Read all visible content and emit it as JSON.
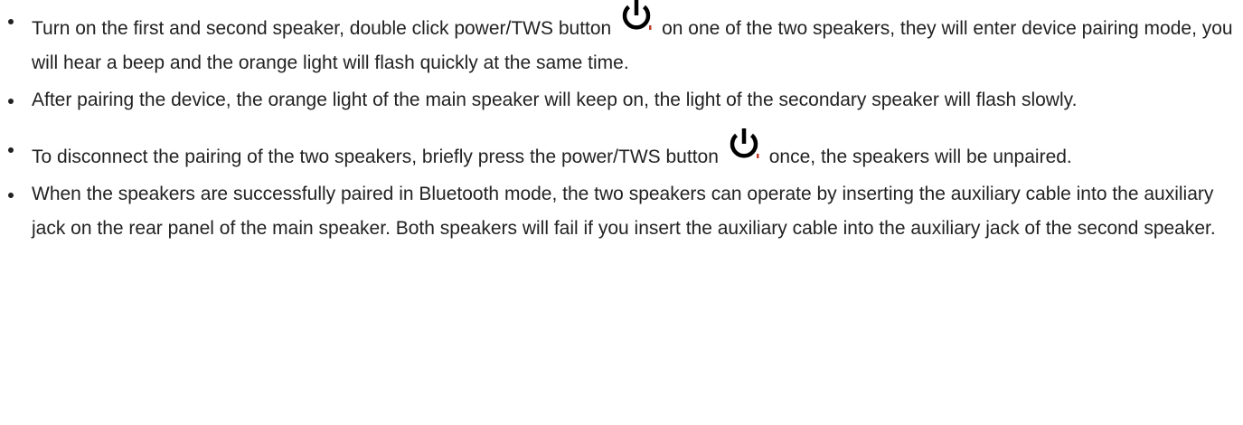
{
  "bullets": [
    {
      "before_icon": "Turn on the first and second speaker, double click power/TWS button",
      "icon": "power-icon",
      "after_icon": "on one of the two speakers, they will enter device pairing mode, you will hear a beep and the orange light will flash quickly at the same time."
    },
    {
      "text": "After pairing the device, the orange light of the main speaker will keep on, the light of the secondary speaker will flash slowly."
    },
    {
      "before_icon": "To disconnect the pairing of the two speakers, briefly press the power/TWS button",
      "icon": "power-icon",
      "after_icon": "once, the speakers will be unpaired."
    },
    {
      "text": "When the speakers are successfully paired in Bluetooth mode, the two speakers can operate by inserting the auxiliary cable into the auxiliary jack on the rear panel of the main speaker. Both speakers will fail if you insert the auxiliary cable into the auxiliary jack of the second speaker."
    }
  ],
  "colors": {
    "text": "#222222",
    "icon": "#000000",
    "icon_accent": "#c0392b"
  }
}
